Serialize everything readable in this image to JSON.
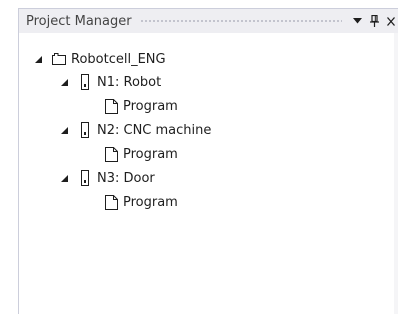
{
  "panel": {
    "title": "Project Manager"
  },
  "tree": {
    "root": {
      "label": "Robotcell_ENG"
    },
    "n1": {
      "label": "N1: Robot",
      "child": "Program"
    },
    "n2": {
      "label": "N2: CNC machine",
      "child": "Program"
    },
    "n3": {
      "label": "N3: Door",
      "child": "Program"
    }
  },
  "icons": {
    "dropdown": "triangle-down-icon",
    "pin": "pin-icon",
    "close": "close-icon",
    "expand": "expanded-triangle-icon",
    "project": "project-folder-icon",
    "device": "device-icon",
    "program": "document-icon"
  },
  "colors": {
    "titlebar": "#eeeef2",
    "border": "#cccedb",
    "text": "#1e1e1e"
  }
}
